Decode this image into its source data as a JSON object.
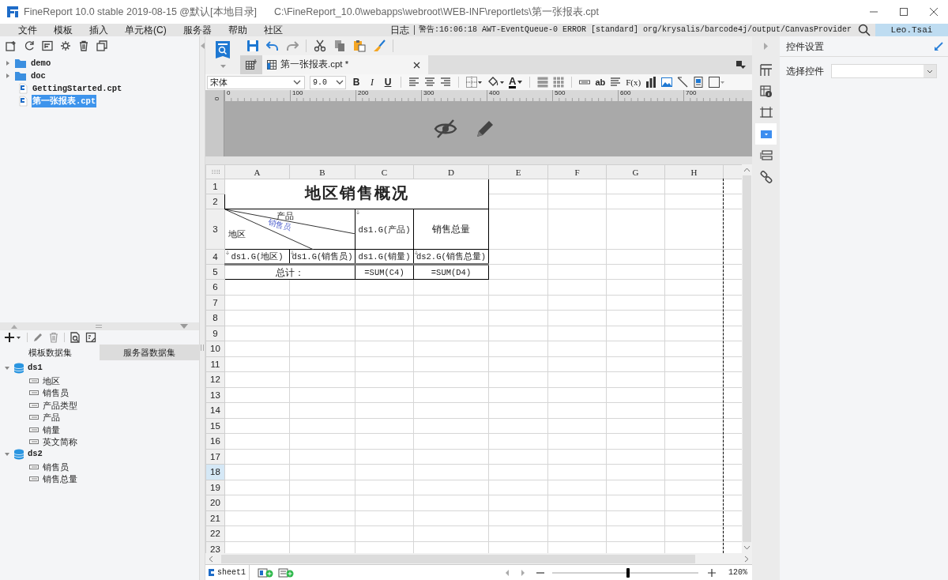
{
  "window": {
    "title": "FineReport 10.0 stable 2019-08-15 @默认[本地目录]",
    "path": "C:\\FineReport_10.0\\webapps\\webroot\\WEB-INF\\reportlets\\第一张报表.cpt"
  },
  "menu": [
    "文件",
    "模板",
    "插入",
    "单元格(C)",
    "服务器",
    "帮助",
    "社区"
  ],
  "log": {
    "label": "日志",
    "message": "警告:16:06:18 AWT-EventQueue-0 ERROR [standard] org/krysalis/barcode4j/output/CanvasProvider"
  },
  "user": "Leo.Tsai",
  "file_tree": [
    {
      "name": "demo",
      "kind": "folder",
      "selected": false
    },
    {
      "name": "doc",
      "kind": "folder",
      "selected": false
    },
    {
      "name": "GettingStarted.cpt",
      "kind": "file",
      "selected": false
    },
    {
      "name": "第一张报表.cpt",
      "kind": "file",
      "selected": true
    }
  ],
  "dataset_tabs": [
    {
      "label": "模板数据集",
      "selected": true
    },
    {
      "label": "服务器数据集",
      "selected": false
    }
  ],
  "datasets": [
    {
      "name": "ds1",
      "expanded": true,
      "children": [
        {
          "name": "地区"
        },
        {
          "name": "销售员"
        },
        {
          "name": "产品类型"
        },
        {
          "name": "产品"
        },
        {
          "name": "销量"
        },
        {
          "name": "英文简称"
        }
      ]
    },
    {
      "name": "ds2",
      "expanded": true,
      "children": [
        {
          "name": "销售员"
        },
        {
          "name": "销售总量"
        }
      ]
    }
  ],
  "editor_tab": {
    "label": "第一张报表.cpt *"
  },
  "format_toolbar": {
    "font": "宋体",
    "size": "9.0",
    "style_buttons": [
      "B",
      "I",
      "U"
    ],
    "font_color_button": "A",
    "text_buttons": [
      "ab",
      "F(x)"
    ]
  },
  "ruler": {
    "marks": [
      "0",
      "100",
      "200",
      "300",
      "400",
      "500",
      "600",
      "700"
    ],
    "side_mark": "0"
  },
  "sheet": {
    "columns": [
      "A",
      "B",
      "C",
      "D",
      "E",
      "F",
      "G",
      "H"
    ],
    "rows": [
      {
        "label": "1",
        "selected": false
      },
      {
        "label": "2",
        "selected": false
      },
      {
        "label": "3",
        "selected": false
      },
      {
        "label": "4",
        "selected": false
      },
      {
        "label": "5",
        "selected": false
      },
      {
        "label": "6",
        "selected": false
      },
      {
        "label": "7",
        "selected": false
      },
      {
        "label": "8",
        "selected": false
      },
      {
        "label": "9",
        "selected": false
      },
      {
        "label": "10",
        "selected": false
      },
      {
        "label": "11",
        "selected": false
      },
      {
        "label": "12",
        "selected": false
      },
      {
        "label": "13",
        "selected": false
      },
      {
        "label": "14",
        "selected": false
      },
      {
        "label": "15",
        "selected": false
      },
      {
        "label": "16",
        "selected": false
      },
      {
        "label": "17",
        "selected": false
      },
      {
        "label": "18",
        "selected": true
      },
      {
        "label": "19",
        "selected": false
      },
      {
        "label": "20",
        "selected": false
      },
      {
        "label": "21",
        "selected": false
      },
      {
        "label": "22",
        "selected": false
      },
      {
        "label": "23",
        "selected": false
      }
    ]
  },
  "report": {
    "title": "地区销售概况",
    "slash": {
      "top": "产品",
      "middle": "销售员",
      "bottom": "地区"
    },
    "header_cells": [
      {
        "text": "ds1.G(产品)",
        "expand_marker": true
      },
      {
        "text": "销售总量",
        "expand_marker": false
      }
    ],
    "detail_cells": [
      {
        "text": "ds1.G(地区)",
        "expand_marker": true
      },
      {
        "text": "ds1.G(销售员)",
        "expand_marker": true
      },
      {
        "text": "ds1.G(销量)",
        "expand_marker": false
      },
      {
        "text": "ds2.G(销售总量)",
        "expand_marker": true
      }
    ],
    "total_label": "总计：",
    "totals": [
      "=SUM(C4)",
      "=SUM(D4)"
    ]
  },
  "sheet_tabs": [
    {
      "label": "sheet1",
      "selected": true
    }
  ],
  "zoom": {
    "level": 0.52,
    "label": "120%"
  },
  "side_tools": [
    {
      "kind": "cell-attr",
      "selected": false
    },
    {
      "kind": "cell-info",
      "selected": false
    },
    {
      "kind": "float",
      "selected": false
    },
    {
      "kind": "widget",
      "selected": true
    },
    {
      "kind": "condition",
      "selected": false
    },
    {
      "kind": "link",
      "selected": false
    }
  ],
  "right_panel": {
    "title": "控件设置",
    "field_label": "选择控件"
  }
}
